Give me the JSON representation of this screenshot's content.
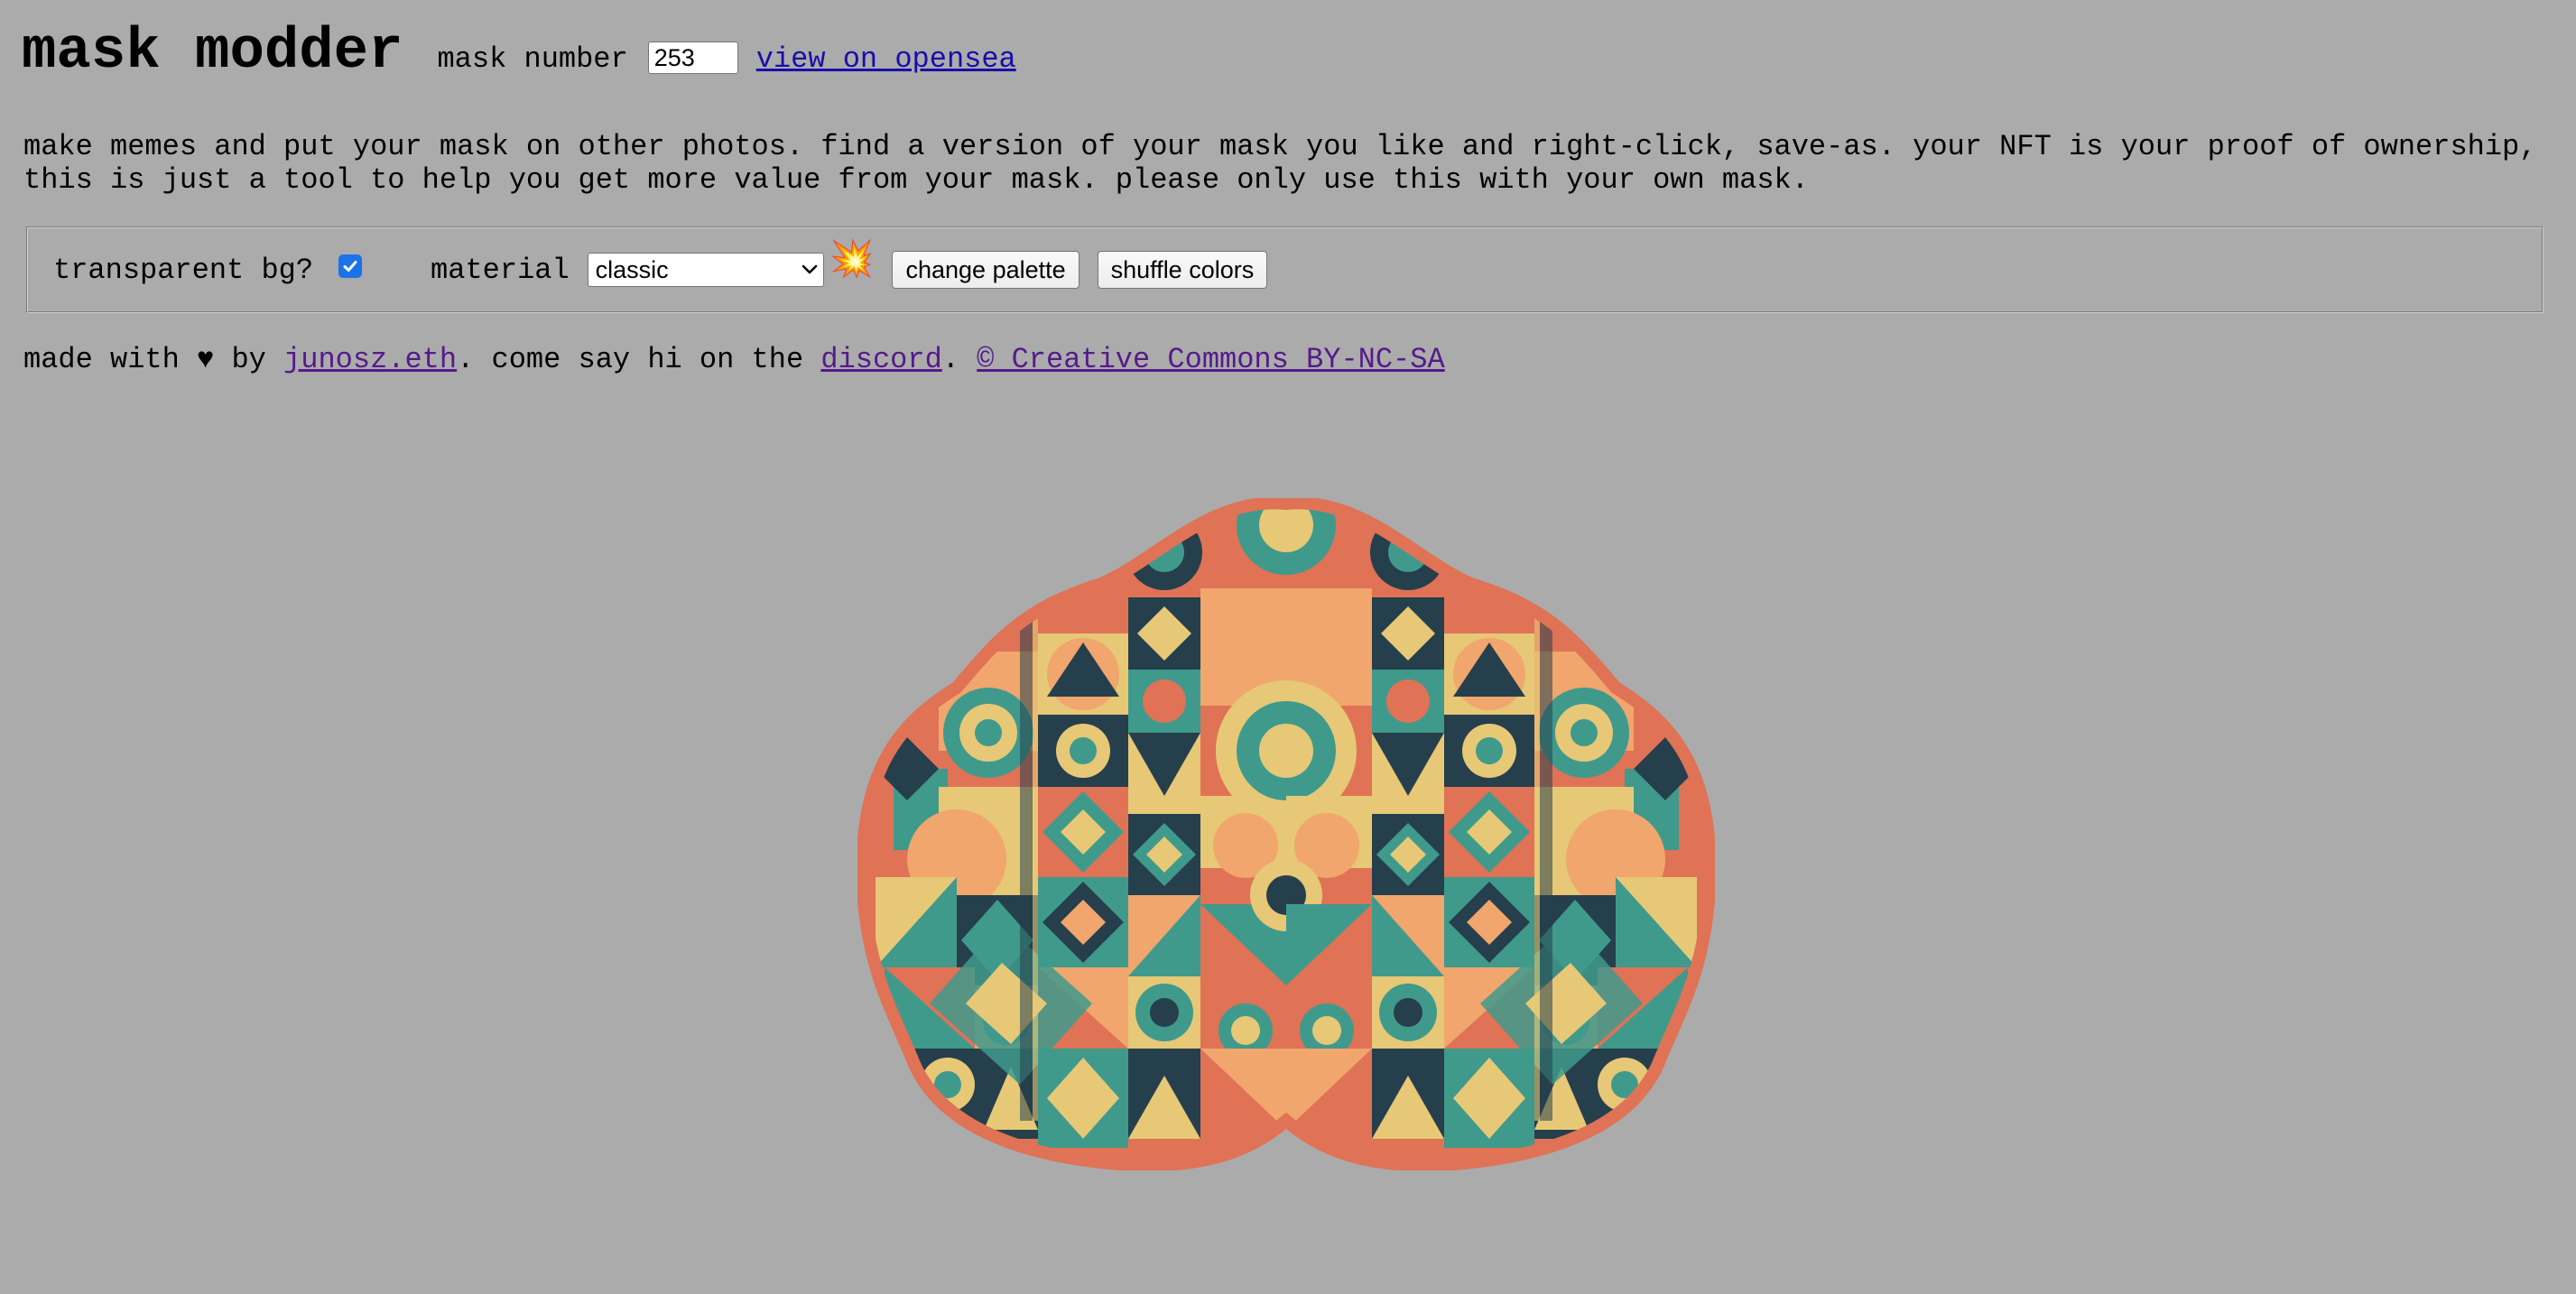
{
  "header": {
    "title": "mask modder",
    "mask_number_label": "mask number",
    "mask_number_value": "253",
    "opensea_link": "view on opensea"
  },
  "intro": {
    "text": "make memes and put your mask on other photos. find a version of your mask you like and right-click, save-as. your NFT is your proof of ownership, this is just a tool to help you get more value from your mask. please only use this with your own mask."
  },
  "controls": {
    "transparent_bg_label": "transparent bg?",
    "transparent_bg_checked": true,
    "material_label": "material",
    "material_selected": "classic",
    "explosion_icon": "💥",
    "change_palette_label": "change palette",
    "shuffle_colors_label": "shuffle colors"
  },
  "footer": {
    "made_with": "made with ♥ by ",
    "author_link": "junosz.eth",
    "middle_text": ". come say hi on the ",
    "discord_link": "discord",
    "separator": ". ",
    "license_link": "© Creative Commons BY-NC-SA"
  },
  "colors": {
    "background": "#ababab",
    "mask_coral": "#e07256",
    "mask_teal": "#3f9a8c",
    "mask_navy": "#263f4c",
    "mask_yellow": "#e6c877",
    "mask_peach": "#f0a66c",
    "link_blue": "#1a0dab",
    "link_visited": "#551a8b"
  }
}
